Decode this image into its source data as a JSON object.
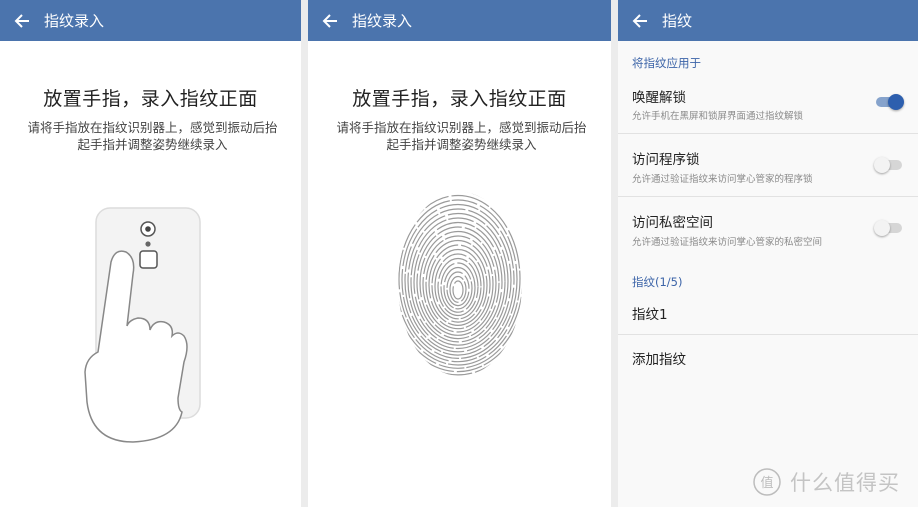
{
  "screens": [
    {
      "appbar": {
        "title": "指纹录入",
        "back_icon": "arrow-left-icon"
      },
      "heading": "放置手指，录入指纹正面",
      "instruction_line1": "请将手指放在指纹识别器上，感觉到振动后抬",
      "instruction_line2": "起手指并调整姿势继续录入",
      "illustration": "finger-on-phone-sensor"
    },
    {
      "appbar": {
        "title": "指纹录入",
        "back_icon": "arrow-left-icon"
      },
      "heading": "放置手指，录入指纹正面",
      "instruction_line1": "请将手指放在指纹识别器上，感觉到振动后抬",
      "instruction_line2": "起手指并调整姿势继续录入",
      "illustration": "fingerprint"
    },
    {
      "appbar": {
        "title": "指纹",
        "back_icon": "arrow-left-icon"
      },
      "apply_section": {
        "header": "将指纹应用于",
        "items": [
          {
            "title": "唤醒解锁",
            "subtitle": "允许手机在黑屏和锁屏界面通过指纹解锁",
            "enabled": true
          },
          {
            "title": "访问程序锁",
            "subtitle": "允许通过验证指纹来访问掌心管家的程序锁",
            "enabled": false
          },
          {
            "title": "访问私密空间",
            "subtitle": "允许通过验证指纹来访问掌心管家的私密空间",
            "enabled": false
          }
        ]
      },
      "fingerprint_section": {
        "header": "指纹(1/5)",
        "items": [
          {
            "label": "指纹1"
          }
        ],
        "add_label": "添加指纹"
      }
    }
  ],
  "watermark": {
    "text": "什么值得买",
    "logo_glyph": "值"
  },
  "colors": {
    "appbar": "#4b74ad",
    "accent": "#2d5fae",
    "section_header": "#3c64a8"
  }
}
